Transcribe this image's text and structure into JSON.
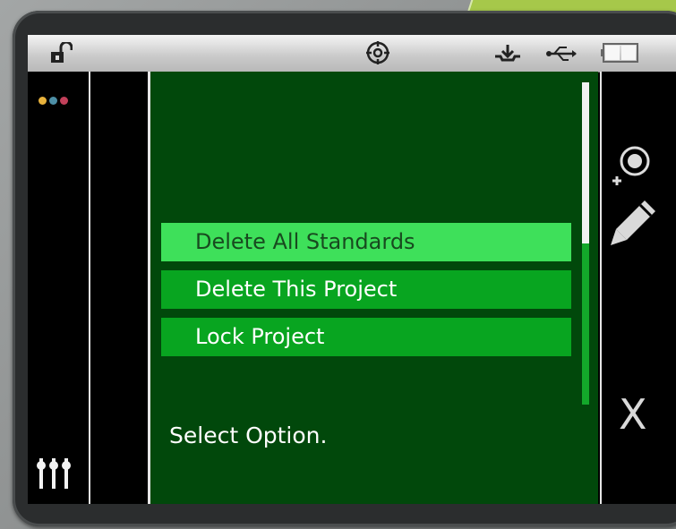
{
  "status_bar": {
    "icons": [
      "unlocked-padlock-icon",
      "target-icon",
      "tray-download-icon",
      "usb-icon",
      "battery-icon"
    ]
  },
  "left_panel": {
    "icons": [
      "three-dots-menu-icon",
      "sliders-icon"
    ],
    "dot_colors": [
      "#e8b23c",
      "#4d8fa6",
      "#c2405a"
    ]
  },
  "menu": {
    "items": [
      {
        "label": "Delete All Standards",
        "selected": true
      },
      {
        "label": "Delete This Project",
        "selected": false
      },
      {
        "label": "Lock Project",
        "selected": false
      }
    ],
    "prompt": "Select Option."
  },
  "right_panel": {
    "icons": [
      "add-target-icon",
      "pencil-icon"
    ],
    "close_label": "X"
  },
  "colors": {
    "panel_bg": "#01480b",
    "item_bg": "#08a520",
    "item_selected_bg": "#3ee05a"
  }
}
